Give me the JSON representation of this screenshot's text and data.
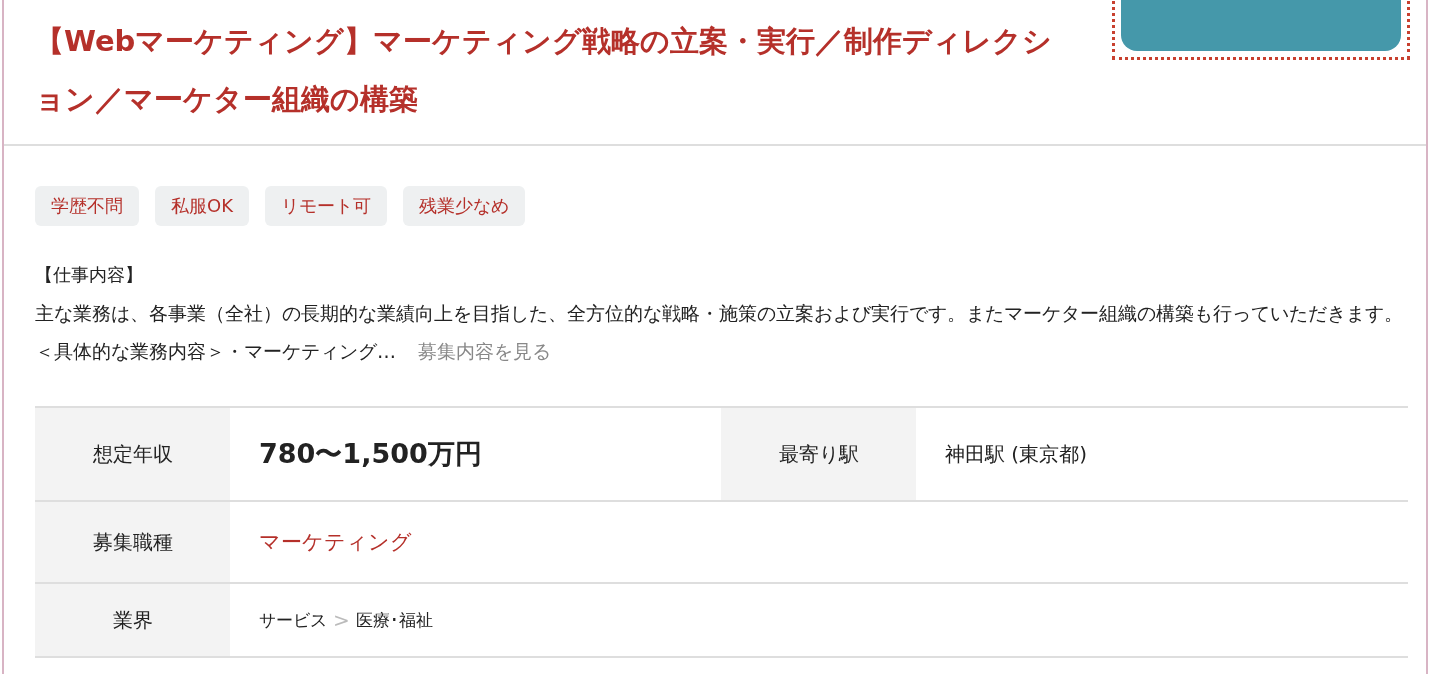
{
  "job": {
    "title": "【Webマーケティング】マーケティング戦略の立案・実行／制作ディレクション／マーケター組織の構築",
    "apply_button": {
      "focused": true
    },
    "tags": [
      "学歴不問",
      "私服OK",
      "リモート可",
      "残業少なめ"
    ],
    "description": {
      "heading": "【仕事内容】",
      "text": "主な業務は、各事業（全社）の長期的な業績向上を目指した、全方位的な戦略・施策の立案および実行です。またマーケター組織の構築も行っていただきます。＜具体的な業務内容＞・マーケティング…",
      "more_link": "募集内容を見る"
    },
    "details": [
      {
        "label": "想定年収",
        "value": "780〜1,500万円",
        "kind": "salary",
        "label2": "最寄り駅",
        "value2": "神田駅 (東京都)"
      },
      {
        "label": "募集職種",
        "value": "マーケティング",
        "kind": "link"
      },
      {
        "label": "業界",
        "kind": "path",
        "parts": [
          "サービス",
          "医療･福祉"
        ],
        "separator": ">"
      }
    ]
  }
}
